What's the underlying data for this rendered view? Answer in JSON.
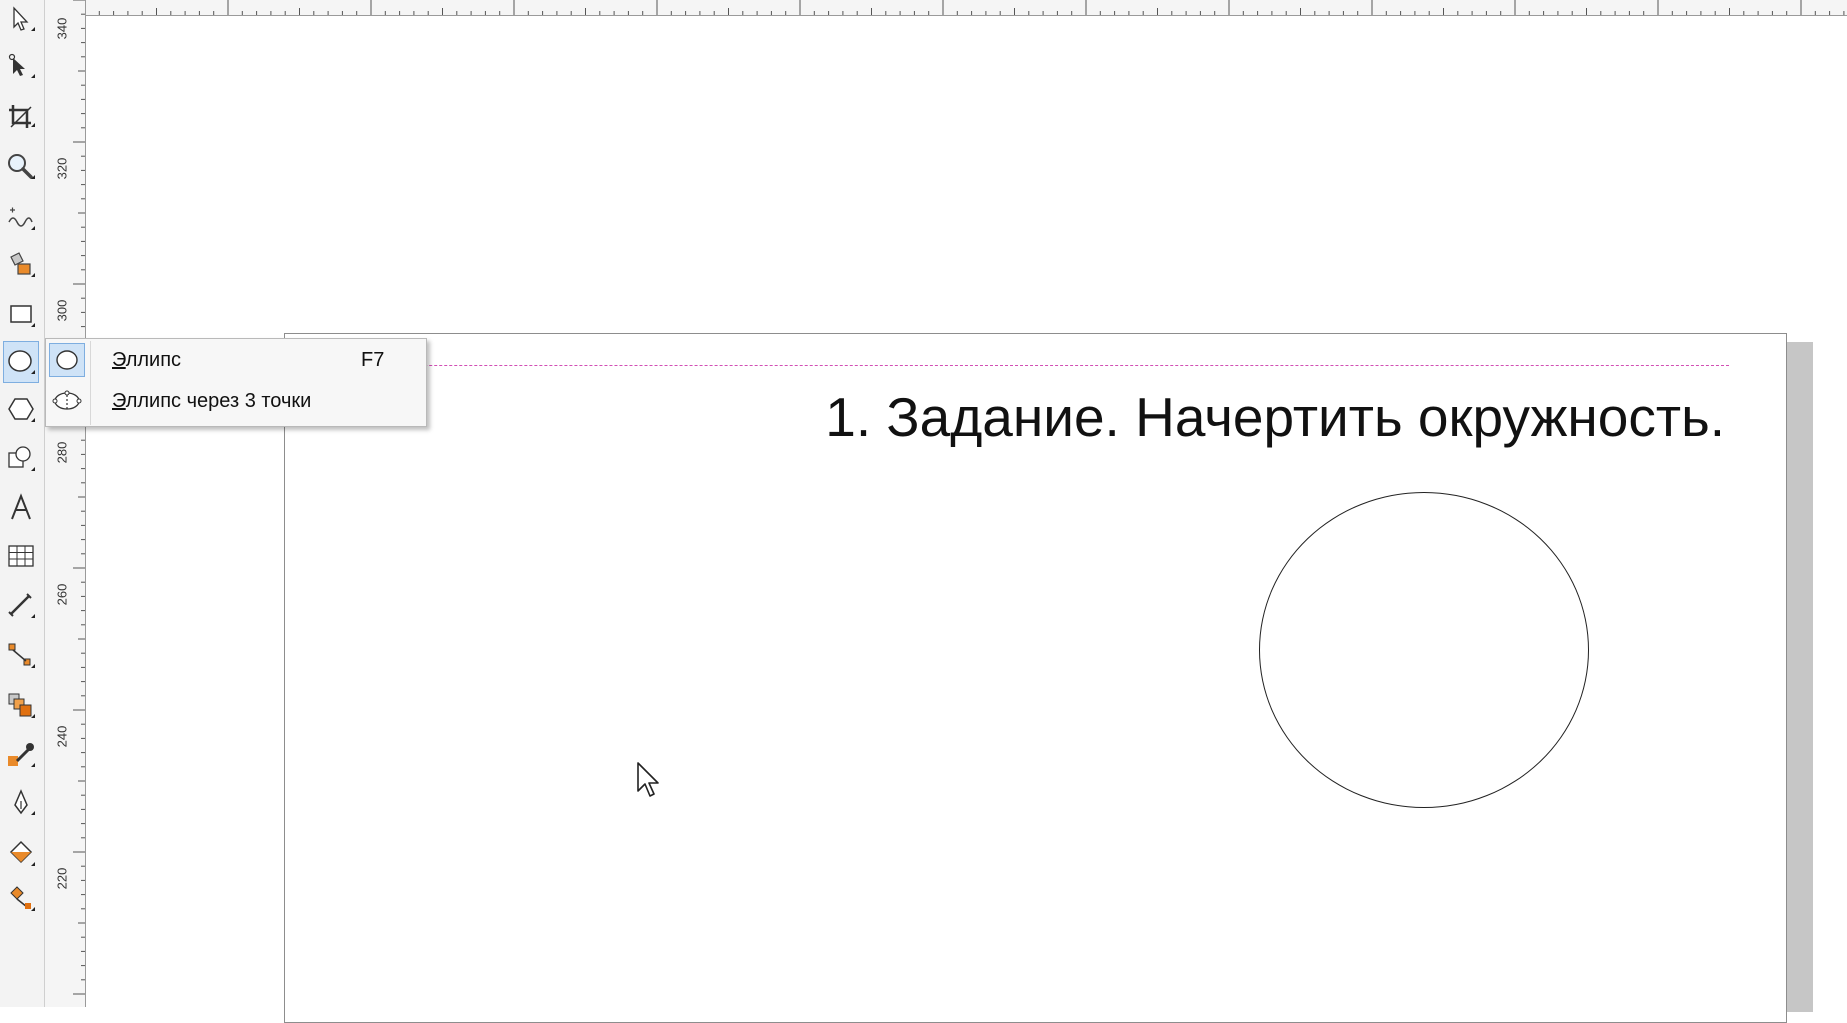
{
  "toolbox": {
    "tools": [
      {
        "name": "pick-tool-icon"
      },
      {
        "name": "shape-tool-icon"
      },
      {
        "name": "crop-tool-icon"
      },
      {
        "name": "zoom-tool-icon"
      },
      {
        "name": "freehand-tool-icon"
      },
      {
        "name": "smart-fill-tool-icon"
      },
      {
        "name": "rectangle-tool-icon"
      },
      {
        "name": "ellipse-tool-icon",
        "active": true
      },
      {
        "name": "polygon-tool-icon"
      },
      {
        "name": "basic-shapes-tool-icon"
      },
      {
        "name": "text-tool-icon"
      },
      {
        "name": "table-tool-icon"
      },
      {
        "name": "dimension-tool-icon"
      },
      {
        "name": "connector-tool-icon"
      },
      {
        "name": "blend-tool-icon"
      },
      {
        "name": "eyedropper-tool-icon"
      },
      {
        "name": "outline-pen-tool-icon"
      },
      {
        "name": "fill-tool-icon"
      },
      {
        "name": "interactive-fill-tool-icon"
      }
    ]
  },
  "ruler": {
    "vertical_labels": [
      "340",
      "320",
      "300",
      "280",
      "260",
      "240",
      "220"
    ]
  },
  "flyout": {
    "items": [
      {
        "accel": "Э",
        "rest": "ллипс",
        "shortcut": "F7",
        "icon": "ellipse-icon",
        "selected": true
      },
      {
        "accel": "Э",
        "rest": "ллипс через 3 точки",
        "shortcut": "",
        "icon": "three-point-ellipse-icon",
        "selected": false
      }
    ]
  },
  "canvas": {
    "title": "1. Задание. Начертить окружность.",
    "guide_color": "#d24fb5"
  },
  "colors": {
    "selection_bg": "#cfe3f7",
    "selection_border": "#7eaee0"
  }
}
